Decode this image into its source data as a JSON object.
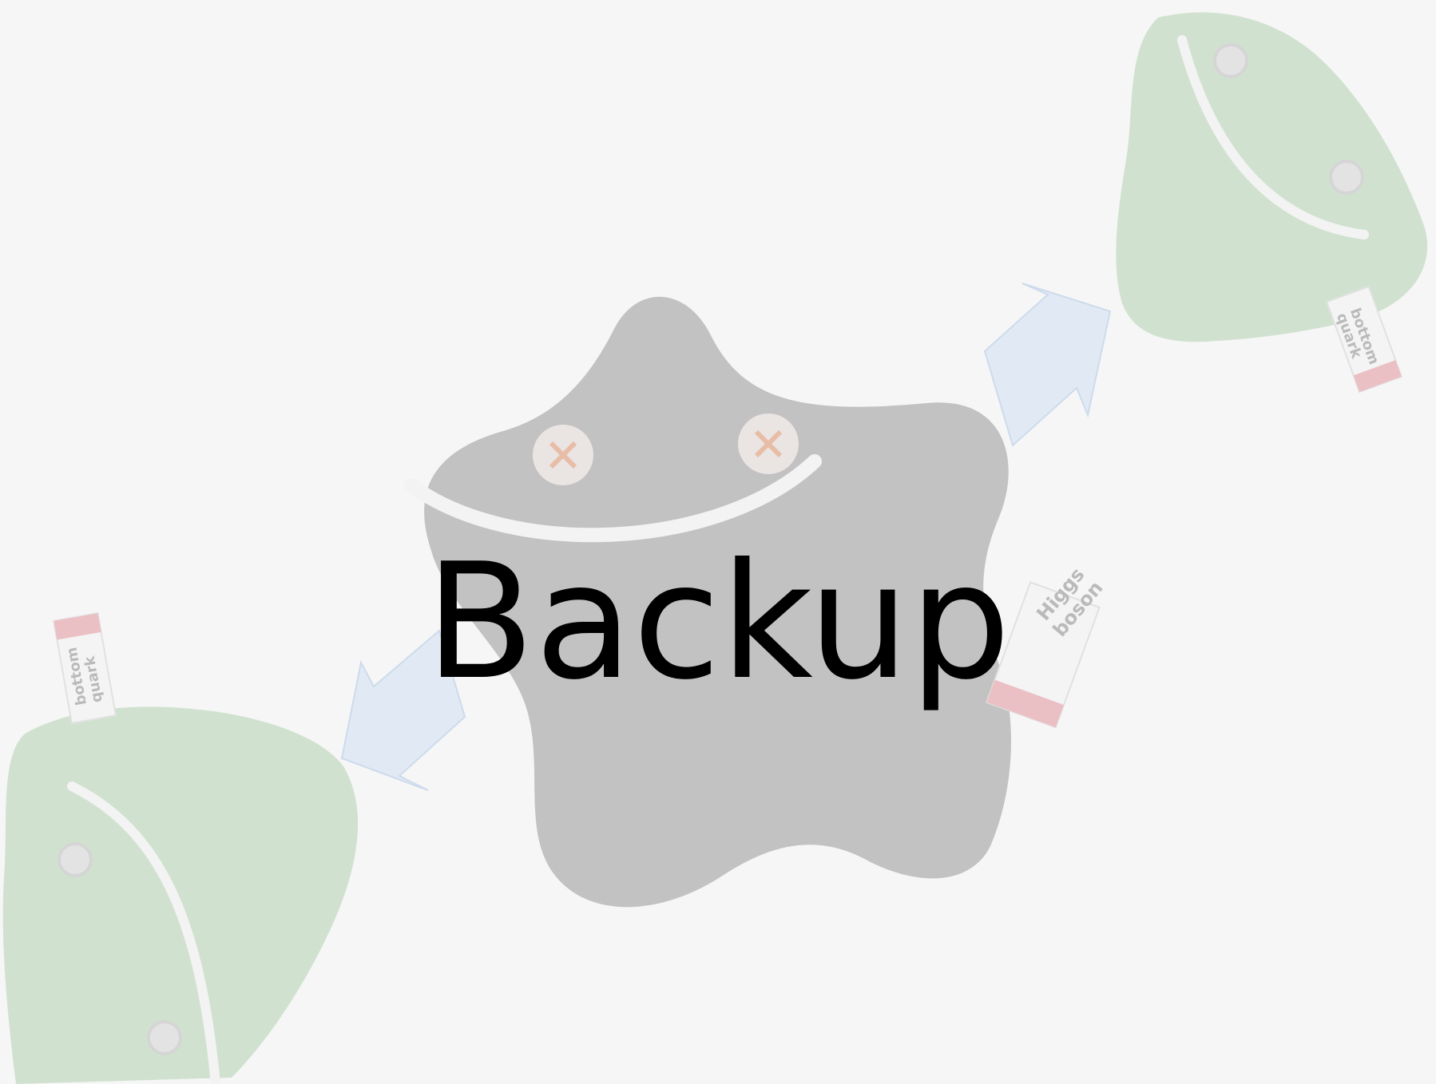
{
  "slide": {
    "title": "Backup"
  },
  "illustration": {
    "higgs_tag_line1": "Higgs",
    "higgs_tag_line2": "boson",
    "right_quark_tag_line1": "bottom",
    "right_quark_tag_line2": "quark",
    "left_quark_tag_line1": "bottom",
    "left_quark_tag_line2": "quark",
    "colors": {
      "background": "#f6f6f6",
      "higgs_plush": "#b9b9b9",
      "quark_plush": "#c9dfc8",
      "arrow": "#dde8f4",
      "title_text": "#000000"
    }
  }
}
